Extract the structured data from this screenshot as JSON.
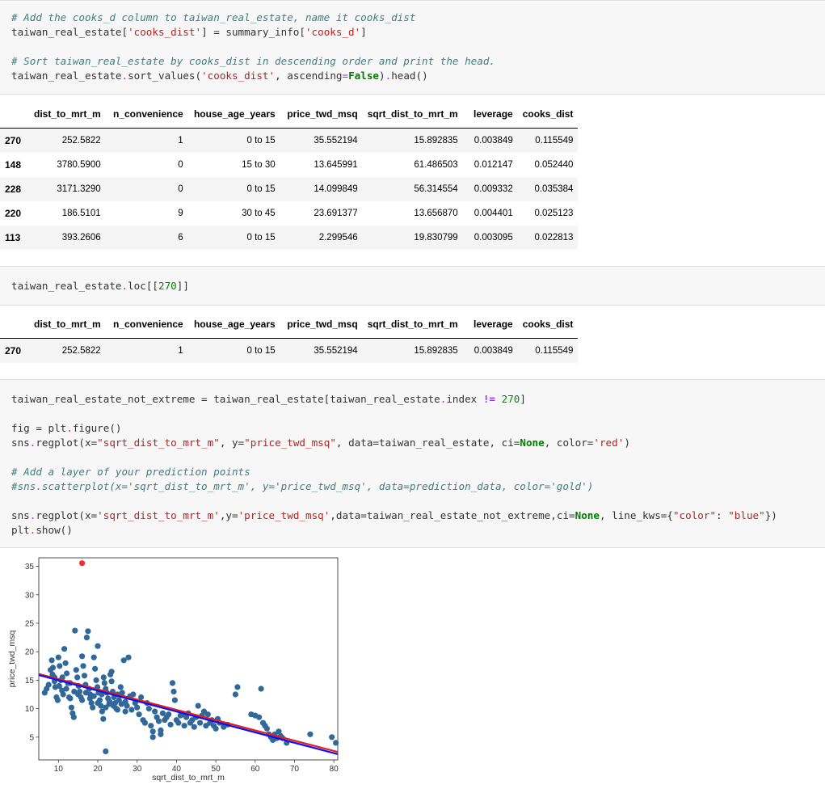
{
  "cells": {
    "cell1": {
      "line1": {
        "comment": "# Add the cooks_d column to taiwan_real_estate, name it cooks_dist",
        "obj": "taiwan_real_estate[",
        "key": "'cooks_dist'",
        "mid": "] = summary_info[",
        "key2": "'cooks_d'",
        "end": "]"
      },
      "line2": {
        "comment": "# Sort taiwan_real_estate by cooks_dist in descending order and print the head.",
        "pre": "taiwan_real_estate",
        "dot": ".",
        "fn": "sort_values(",
        "arg": "'cooks_dist'",
        "mid": ", ascending",
        "eq": "=",
        "kw": "False",
        "close": ")",
        "dot2": ".",
        "tail": "head()"
      }
    },
    "cell2": {
      "pre": "taiwan_real_estate",
      "dot": ".",
      "fn": "loc[[",
      "num": "270",
      "end": "]]"
    },
    "cell3": {
      "l1": {
        "a": "taiwan_real_estate_not_extreme = taiwan_real_estate[taiwan_real_estate",
        "dot": ".",
        "b": "index ",
        "op": "!=",
        "sp": " ",
        "num": "270",
        "c": "]"
      },
      "l2": {
        "a": "fig = plt",
        "dot": ".",
        "b": "figure()"
      },
      "l3": {
        "a": "sns",
        "dot": ".",
        "b": "regplot(x=",
        "s1": "\"sqrt_dist_to_mrt_m\"",
        "c": ", y=",
        "s2": "\"price_twd_msq\"",
        "d": ", data=taiwan_real_estate, ci=",
        "kw": "None",
        "e": ", color=",
        "s3": "'red'",
        "f": ")"
      },
      "l4": "# Add a layer of your prediction points",
      "l5": "#sns.scatterplot(x='sqrt_dist_to_mrt_m', y='price_twd_msq', data=prediction_data, color='gold')",
      "l6": {
        "a": "sns",
        "dot": ".",
        "b": "regplot(x=",
        "s1": "'sqrt_dist_to_mrt_m'",
        "c": ",y=",
        "s2": "'price_twd_msq'",
        "d": ",data=taiwan_real_estate_not_extreme,ci=",
        "kw": "None",
        "e": ", line_kws={",
        "s3": "\"color\"",
        "f": ": ",
        "s4": "\"blue\"",
        "g": "})"
      },
      "l7": {
        "a": "plt",
        "dot": ".",
        "b": "show()"
      }
    }
  },
  "table1": {
    "columns": [
      "",
      "dist_to_mrt_m",
      "n_convenience",
      "house_age_years",
      "price_twd_msq",
      "sqrt_dist_to_mrt_m",
      "leverage",
      "cooks_dist"
    ],
    "rows": [
      [
        "270",
        "252.5822",
        "1",
        "0 to 15",
        "35.552194",
        "15.892835",
        "0.003849",
        "0.115549"
      ],
      [
        "148",
        "3780.5900",
        "0",
        "15 to 30",
        "13.645991",
        "61.486503",
        "0.012147",
        "0.052440"
      ],
      [
        "228",
        "3171.3290",
        "0",
        "0 to 15",
        "14.099849",
        "56.314554",
        "0.009332",
        "0.035384"
      ],
      [
        "220",
        "186.5101",
        "9",
        "30 to 45",
        "23.691377",
        "13.656870",
        "0.004401",
        "0.025123"
      ],
      [
        "113",
        "393.2606",
        "6",
        "0 to 15",
        "2.299546",
        "19.830799",
        "0.003095",
        "0.022813"
      ]
    ]
  },
  "table2": {
    "columns": [
      "",
      "dist_to_mrt_m",
      "n_convenience",
      "house_age_years",
      "price_twd_msq",
      "sqrt_dist_to_mrt_m",
      "leverage",
      "cooks_dist"
    ],
    "rows": [
      [
        "270",
        "252.5822",
        "1",
        "0 to 15",
        "35.552194",
        "15.892835",
        "0.003849",
        "0.115549"
      ]
    ]
  },
  "chart_data": {
    "type": "scatter",
    "xlabel": "sqrt_dist_to_mrt_m",
    "ylabel": "price_twd_msq",
    "xlim": [
      5,
      81
    ],
    "ylim": [
      1,
      36.5
    ],
    "xticks": [
      10,
      20,
      30,
      40,
      50,
      60,
      70,
      80
    ],
    "yticks": [
      5,
      10,
      15,
      20,
      25,
      30,
      35
    ],
    "grid": false,
    "colors": {
      "points": "#31689a",
      "outlier": "#f03030",
      "line": "#1010ee",
      "red_line": "#e02020"
    },
    "series": [
      {
        "points": [
          [
            6.5,
            12.8
          ],
          [
            7.0,
            13.5
          ],
          [
            7.5,
            14.2
          ],
          [
            8.0,
            16.8
          ],
          [
            8.3,
            18.5
          ],
          [
            8.6,
            17.2
          ],
          [
            9.0,
            15.5
          ],
          [
            9.2,
            13.8
          ],
          [
            9.5,
            12.0
          ],
          [
            9.8,
            11.5
          ],
          [
            10.0,
            19.0
          ],
          [
            10.3,
            17.5
          ],
          [
            10.6,
            15.0
          ],
          [
            10.9,
            13.2
          ],
          [
            11.2,
            12.5
          ],
          [
            11.5,
            20.5
          ],
          [
            11.8,
            18.0
          ],
          [
            12.1,
            16.2
          ],
          [
            12.4,
            14.5
          ],
          [
            12.7,
            12.0
          ],
          [
            13.0,
            11.8
          ],
          [
            13.3,
            10.2
          ],
          [
            13.6,
            9.2
          ],
          [
            13.9,
            8.5
          ],
          [
            14.2,
            23.7
          ],
          [
            14.5,
            16.8
          ],
          [
            14.8,
            15.5
          ],
          [
            15.1,
            14.0
          ],
          [
            15.4,
            13.0
          ],
          [
            15.7,
            12.0
          ],
          [
            16.0,
            19.2
          ],
          [
            16.3,
            17.5
          ],
          [
            16.6,
            15.8
          ],
          [
            16.9,
            14.2
          ],
          [
            17.2,
            22.5
          ],
          [
            17.5,
            23.6
          ],
          [
            17.8,
            13.5
          ],
          [
            18.1,
            12.5
          ],
          [
            18.4,
            11.0
          ],
          [
            18.7,
            10.2
          ],
          [
            19.0,
            19.0
          ],
          [
            19.3,
            17.0
          ],
          [
            19.6,
            15.0
          ],
          [
            19.9,
            13.8
          ],
          [
            20.2,
            12.8
          ],
          [
            20.5,
            11.5
          ],
          [
            20.8,
            10.5
          ],
          [
            21.1,
            9.5
          ],
          [
            21.4,
            8.2
          ],
          [
            21.7,
            14.5
          ],
          [
            22.0,
            13.5
          ],
          [
            22.3,
            12.8
          ],
          [
            22.6,
            11.8
          ],
          [
            22.9,
            10.8
          ],
          [
            23.2,
            16.0
          ],
          [
            23.5,
            14.8
          ],
          [
            23.8,
            13.0
          ],
          [
            24.1,
            12.0
          ],
          [
            24.4,
            11.0
          ],
          [
            24.7,
            10.0
          ],
          [
            25.0,
            12.5
          ],
          [
            25.4,
            11.5
          ],
          [
            25.8,
            13.8
          ],
          [
            26.2,
            12.8
          ],
          [
            26.6,
            18.5
          ],
          [
            27.0,
            11.2
          ],
          [
            27.4,
            10.5
          ],
          [
            27.8,
            19.0
          ],
          [
            28.2,
            12.2
          ],
          [
            28.6,
            9.8
          ],
          [
            29.0,
            12.5
          ],
          [
            29.5,
            11.0
          ],
          [
            30.0,
            10.2
          ],
          [
            30.5,
            9.0
          ],
          [
            31.0,
            12.0
          ],
          [
            31.5,
            8.0
          ],
          [
            32.0,
            7.5
          ],
          [
            32.5,
            11.0
          ],
          [
            33.0,
            10.0
          ],
          [
            33.5,
            7.0
          ],
          [
            34.0,
            6.0
          ],
          [
            34.5,
            9.5
          ],
          [
            35.0,
            8.5
          ],
          [
            35.5,
            7.8
          ],
          [
            36.0,
            6.2
          ],
          [
            36.5,
            9.2
          ],
          [
            37.0,
            8.0
          ],
          [
            37.5,
            8.5
          ],
          [
            38.0,
            9.0
          ],
          [
            38.5,
            7.2
          ],
          [
            39.0,
            14.5
          ],
          [
            39.3,
            13.0
          ],
          [
            39.6,
            11.5
          ],
          [
            40.0,
            8.0
          ],
          [
            40.5,
            7.5
          ],
          [
            41.0,
            8.8
          ],
          [
            41.5,
            9.0
          ],
          [
            42.0,
            7.0
          ],
          [
            42.5,
            8.5
          ],
          [
            43.0,
            9.2
          ],
          [
            43.5,
            7.5
          ],
          [
            44.0,
            8.0
          ],
          [
            44.5,
            6.8
          ],
          [
            45.0,
            8.5
          ],
          [
            45.5,
            10.5
          ],
          [
            46.0,
            7.5
          ],
          [
            46.5,
            8.8
          ],
          [
            47.0,
            9.5
          ],
          [
            47.5,
            7.0
          ],
          [
            48.0,
            9.0
          ],
          [
            48.5,
            7.5
          ],
          [
            49.0,
            8.0
          ],
          [
            49.5,
            7.0
          ],
          [
            50.0,
            6.5
          ],
          [
            50.5,
            8.2
          ],
          [
            51.0,
            7.5
          ],
          [
            52.0,
            6.8
          ],
          [
            53.0,
            7.2
          ],
          [
            55.0,
            12.5
          ],
          [
            55.5,
            13.8
          ],
          [
            59.0,
            9.0
          ],
          [
            60.0,
            8.8
          ],
          [
            61.0,
            8.5
          ],
          [
            61.5,
            13.5
          ],
          [
            62.0,
            7.5
          ],
          [
            62.5,
            7.0
          ],
          [
            63.0,
            6.5
          ],
          [
            63.5,
            5.5
          ],
          [
            64.0,
            5.0
          ],
          [
            64.5,
            4.5
          ],
          [
            65.0,
            5.5
          ],
          [
            65.5,
            4.8
          ],
          [
            66.0,
            6.0
          ],
          [
            66.5,
            5.2
          ],
          [
            67.0,
            4.8
          ],
          [
            68.0,
            4.0
          ],
          [
            74.0,
            5.5
          ],
          [
            79.5,
            5.0
          ],
          [
            80.5,
            4.0
          ],
          [
            8.5,
            16.0
          ],
          [
            9.0,
            14.8
          ],
          [
            10.2,
            14.0
          ],
          [
            11.0,
            15.5
          ],
          [
            12.0,
            13.5
          ],
          [
            13.0,
            14.5
          ],
          [
            14.0,
            13.0
          ],
          [
            15.0,
            12.5
          ],
          [
            16.0,
            11.5
          ],
          [
            17.0,
            12.8
          ],
          [
            18.0,
            11.8
          ],
          [
            19.0,
            12.2
          ],
          [
            20.0,
            11.0
          ],
          [
            21.0,
            12.5
          ],
          [
            22.0,
            10.2
          ],
          [
            23.0,
            11.2
          ],
          [
            24.0,
            10.5
          ],
          [
            25.0,
            9.8
          ],
          [
            26.0,
            10.8
          ],
          [
            27.0,
            9.5
          ],
          [
            21.5,
            15.5
          ],
          [
            23.5,
            16.5
          ],
          [
            20.0,
            21.0
          ],
          [
            22.0,
            2.5
          ],
          [
            34.0,
            5.0
          ],
          [
            36.0,
            5.5
          ]
        ]
      }
    ],
    "outlier": [
      16.0,
      35.55
    ],
    "regression_lines": {
      "blue": [
        [
          5,
          15.9
        ],
        [
          81,
          2.0
        ]
      ],
      "red": [
        [
          5,
          16.1
        ],
        [
          81,
          2.4
        ]
      ]
    }
  }
}
